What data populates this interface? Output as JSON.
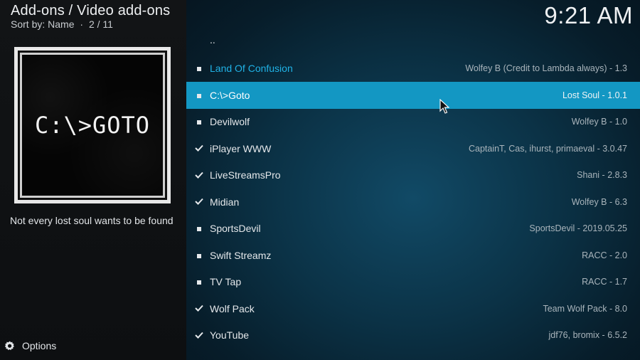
{
  "header": {
    "title": "Add-ons / Video add-ons",
    "sort": "Sort by: Name",
    "separator": "·",
    "position": "2 / 11"
  },
  "clock": "9:21 AM",
  "preview": {
    "poster_text": "C:\\>GOTO",
    "description": "Not every lost soul wants to be found"
  },
  "footer": {
    "options_label": "Options",
    "options_icon": "gear-icon"
  },
  "list": {
    "parent": "..",
    "items": [
      {
        "name": "Land Of Confusion",
        "info": "Wolfey B (Credit to Lambda always) - 1.3",
        "status": "dot",
        "focused_name": true
      },
      {
        "name": "C:\\>Goto",
        "info": "Lost Soul - 1.0.1",
        "status": "dot",
        "selected": true
      },
      {
        "name": "Devilwolf",
        "info": "Wolfey B - 1.0",
        "status": "dot"
      },
      {
        "name": "iPlayer WWW",
        "info": "CaptainT, Cas, ihurst, primaeval - 3.0.47",
        "status": "check"
      },
      {
        "name": "LiveStreamsPro",
        "info": "Shani - 2.8.3",
        "status": "check"
      },
      {
        "name": "Midian",
        "info": "Wolfey B - 6.3",
        "status": "check"
      },
      {
        "name": "SportsDevil",
        "info": "SportsDevil - 2019.05.25",
        "status": "dot"
      },
      {
        "name": "Swift Streamz",
        "info": "RACC - 2.0",
        "status": "dot"
      },
      {
        "name": "TV Tap",
        "info": "RACC - 1.7",
        "status": "dot"
      },
      {
        "name": "Wolf Pack",
        "info": "Team Wolf Pack - 8.0",
        "status": "check"
      },
      {
        "name": "YouTube",
        "info": "jdf76, bromix - 6.5.2",
        "status": "check"
      }
    ]
  },
  "colors": {
    "selected_row": "#1397c3",
    "active_text": "#20b2e6",
    "list_bg": "#0b3246"
  }
}
